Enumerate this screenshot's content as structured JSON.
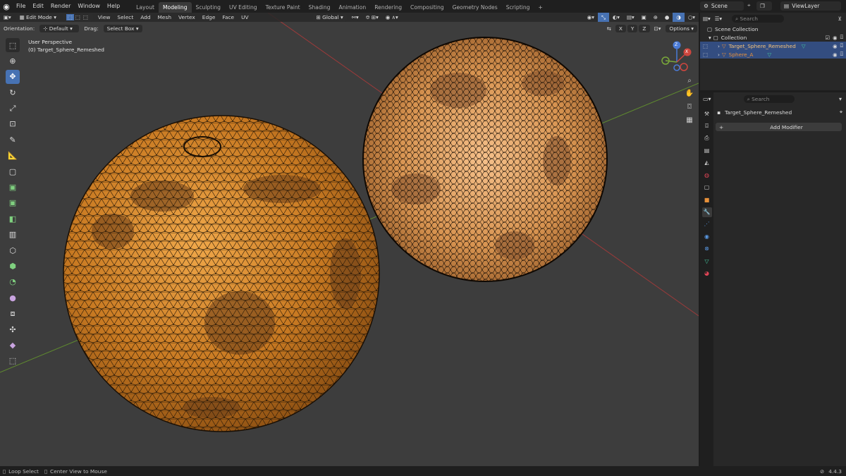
{
  "topbar": {
    "menus": [
      "File",
      "Edit",
      "Render",
      "Window",
      "Help"
    ],
    "workspaces": [
      "Layout",
      "Modeling",
      "Sculpting",
      "UV Editing",
      "Texture Paint",
      "Shading",
      "Animation",
      "Rendering",
      "Compositing",
      "Geometry Nodes",
      "Scripting"
    ],
    "active_workspace": "Modeling",
    "scene": "Scene",
    "search_placeholder": "Search",
    "view_layer": "ViewLayer"
  },
  "viewport_header": {
    "mode": "Edit Mode",
    "menus": [
      "View",
      "Select",
      "Add",
      "Mesh",
      "Vertex",
      "Edge",
      "Face",
      "UV"
    ],
    "transform": "Global",
    "axes": [
      "X",
      "Y",
      "Z"
    ],
    "options": "Options"
  },
  "tool_header": {
    "orientation_label": "Orientation:",
    "orientation_value": "Default",
    "drag_label": "Drag:",
    "drag_value": "Select Box"
  },
  "viewport": {
    "perspective": "User Perspective",
    "object_info": "(0) Target_Sphere_Remeshed",
    "gizmo": {
      "x": "X",
      "y": "Y",
      "z": "Z"
    }
  },
  "outliner": {
    "scene_collection": "Scene Collection",
    "collection": "Collection",
    "objects": [
      "Target_Sphere_Remeshed",
      "Sphere_A"
    ]
  },
  "properties": {
    "search_placeholder": "Search",
    "object_name": "Target_Sphere_Remeshed",
    "add_modifier": "Add Modifier"
  },
  "statusbar": {
    "left1": "Loop Select",
    "left2": "Center View to Mouse",
    "version": "4.4.3"
  },
  "colors": {
    "accent": "#4772b3",
    "sphere": "#d98a2a",
    "selection": "#334d80"
  }
}
